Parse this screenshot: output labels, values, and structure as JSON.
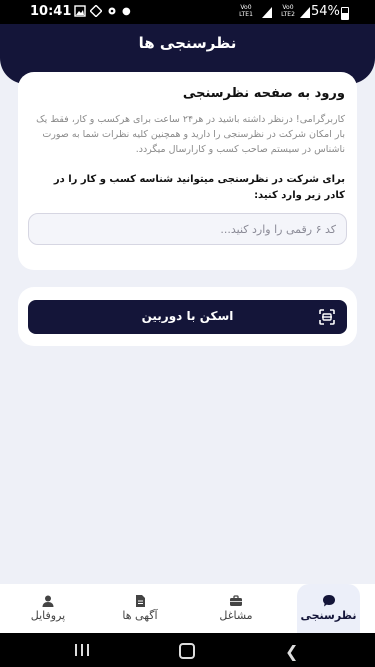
{
  "status_bar": {
    "time": "10:41",
    "network1": "Vo0 LTE1",
    "network2": "Vo0 LTE2",
    "battery": "54%"
  },
  "header": {
    "title": "نظرسنجی ها"
  },
  "login_card": {
    "title": "ورود به صفحه نظرسنجی",
    "description": "کاربرگرامی! درنظر داشته باشید در هر۲۴ ساعت برای هرکسب و کار، فقط یک بار امکان شرکت در نظرسنجی را دارید و همچنین کلیه نظرات شما به صورت ناشناس در سیستم صاحب کسب و کارارسال میگردد.",
    "instruction": "برای شرکت در نظرسنجی میتوانید شناسه کسب و کار را در کادر زیر وارد کنید:",
    "input_placeholder": "کد ۶ رقمی را وارد کنید...",
    "input_value": ""
  },
  "scan_card": {
    "button_label": "اسکن با دوربین"
  },
  "bottom_nav": {
    "items": [
      {
        "label": "نظرسنجی",
        "icon": "chat-bubble-icon",
        "active": true
      },
      {
        "label": "مشاغل",
        "icon": "briefcase-icon",
        "active": false
      },
      {
        "label": "آگهی ها",
        "icon": "document-icon",
        "active": false
      },
      {
        "label": "پروفایل",
        "icon": "user-icon",
        "active": false
      }
    ]
  },
  "colors": {
    "primary": "#141539",
    "background": "#eef0f7",
    "card": "#ffffff"
  }
}
